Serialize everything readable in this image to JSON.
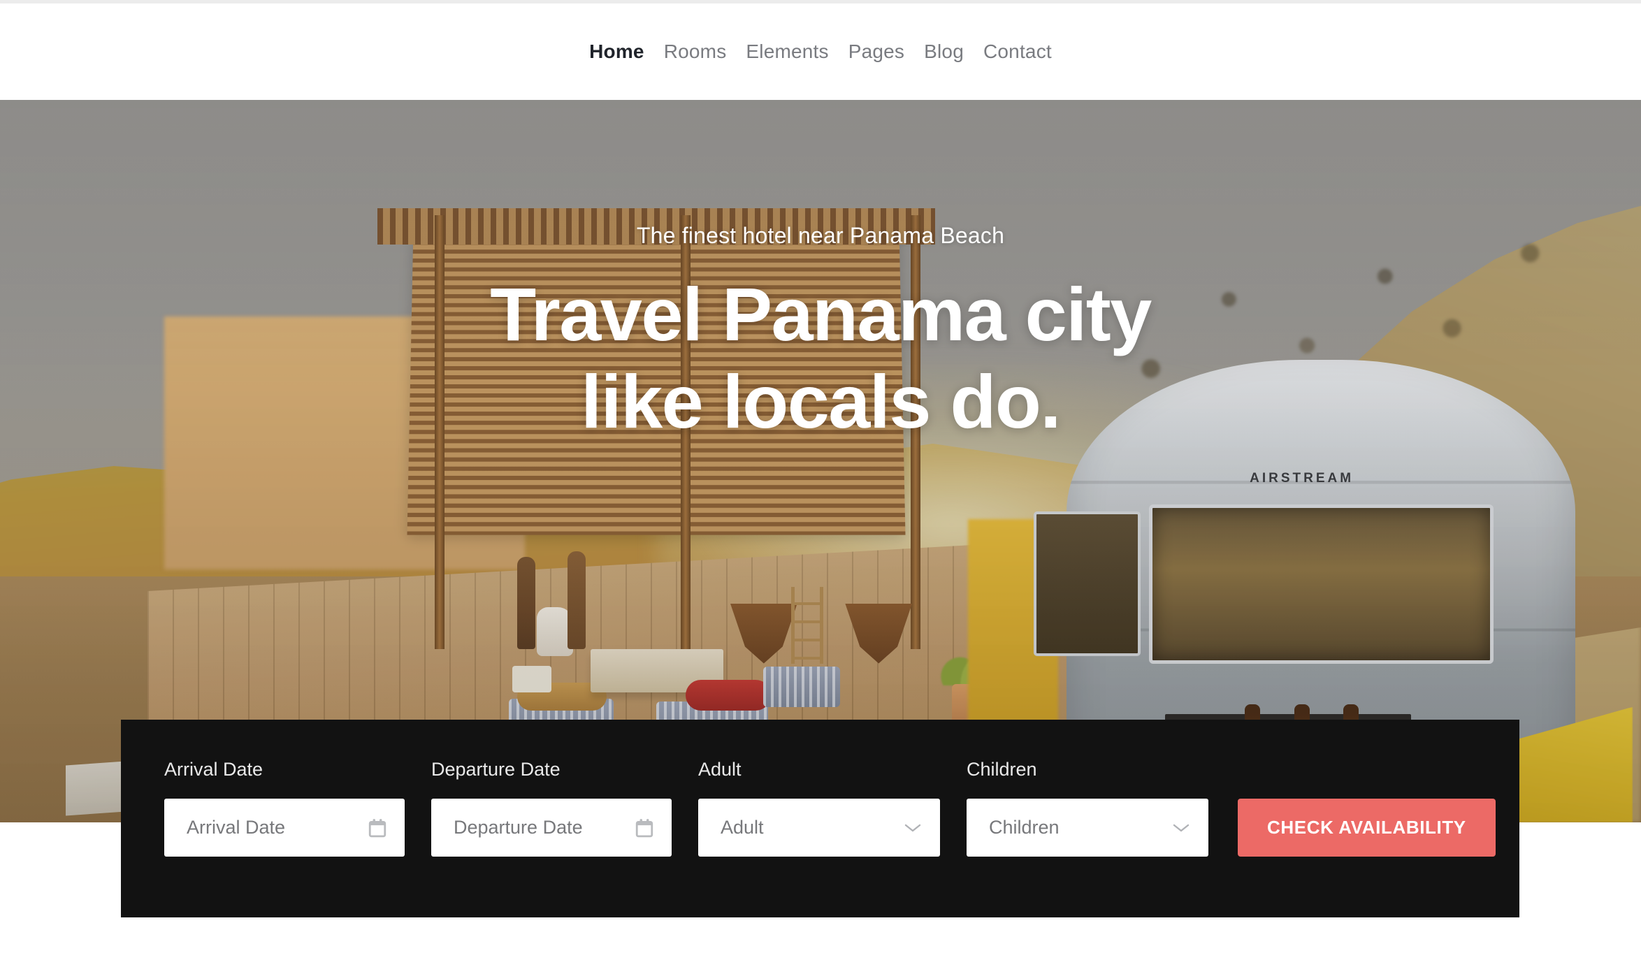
{
  "header": {
    "nav": [
      {
        "label": "Home",
        "active": true,
        "name": "nav-item-home"
      },
      {
        "label": "Rooms",
        "active": false,
        "name": "nav-item-rooms"
      },
      {
        "label": "Elements",
        "active": false,
        "name": "nav-item-elements"
      },
      {
        "label": "Pages",
        "active": false,
        "name": "nav-item-pages"
      },
      {
        "label": "Blog",
        "active": false,
        "name": "nav-item-blog"
      },
      {
        "label": "Contact",
        "active": false,
        "name": "nav-item-contact"
      }
    ]
  },
  "hero": {
    "subtitle": "The finest hotel near Panama Beach",
    "title_line1": "Travel Panama city",
    "title_line2": "like locals do.",
    "image_alt": "Airstream trailer beside a wooden deck lounge at sunset",
    "trailer_badge": "AIRSTREAM"
  },
  "booking": {
    "arrival": {
      "label": "Arrival Date",
      "placeholder": "Arrival Date",
      "value": "",
      "icon": "calendar-icon"
    },
    "departure": {
      "label": "Departure Date",
      "placeholder": "Departure Date",
      "value": "",
      "icon": "calendar-icon"
    },
    "adult": {
      "label": "Adult",
      "selected": "Adult",
      "icon": "chevron-down-icon"
    },
    "children": {
      "label": "Children",
      "selected": "Children",
      "icon": "chevron-down-icon"
    },
    "submit_label": "CHECK AVAILABILITY"
  },
  "colors": {
    "accent": "#ec6a66",
    "panel_bg": "#121212",
    "nav_active": "#20242b",
    "nav_inactive": "#797b80",
    "placeholder": "#77787b",
    "label": "#e9e9e9",
    "page_bg": "#ffffff"
  }
}
